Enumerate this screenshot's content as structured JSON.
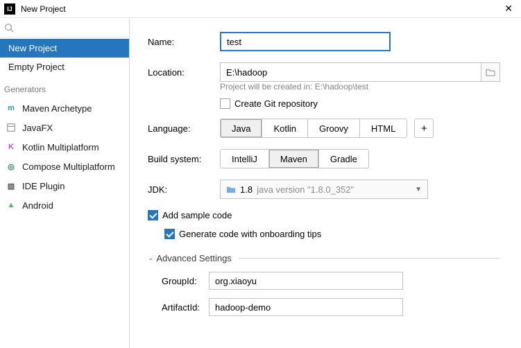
{
  "window": {
    "title": "New Project"
  },
  "sidebar": {
    "items": [
      {
        "label": "New Project"
      },
      {
        "label": "Empty Project"
      }
    ],
    "generators_header": "Generators",
    "generators": [
      {
        "label": "Maven Archetype",
        "icon_letter": "m",
        "icon_color": "#1f93d4"
      },
      {
        "label": "JavaFX",
        "icon_letter": "",
        "icon_color": "#7a7a7a"
      },
      {
        "label": "Kotlin Multiplatform",
        "icon_letter": "K",
        "icon_color": "#b84fe0"
      },
      {
        "label": "Compose Multiplatform",
        "icon_letter": "◎",
        "icon_color": "#2c7f6f"
      },
      {
        "label": "IDE Plugin",
        "icon_letter": "▧",
        "icon_color": "#5a5a5a"
      },
      {
        "label": "Android",
        "icon_letter": "▲",
        "icon_color": "#3bbd64"
      }
    ]
  },
  "form": {
    "name_label": "Name:",
    "name_value": "test",
    "location_label": "Location:",
    "location_value": "E:\\hadoop",
    "location_hint": "Project will be created in: E:\\hadoop\\test",
    "create_git_label": "Create Git repository",
    "language_label": "Language:",
    "languages": [
      {
        "label": "Java"
      },
      {
        "label": "Kotlin"
      },
      {
        "label": "Groovy"
      },
      {
        "label": "HTML"
      }
    ],
    "buildsystem_label": "Build system:",
    "buildsystems": [
      {
        "label": "IntelliJ"
      },
      {
        "label": "Maven"
      },
      {
        "label": "Gradle"
      }
    ],
    "jdk_label": "JDK:",
    "jdk_version": "1.8",
    "jdk_desc": "java version \"1.8.0_352\"",
    "add_sample_label": "Add sample code",
    "onboarding_label": "Generate code with onboarding tips",
    "advanced_header": "Advanced Settings",
    "groupid_label": "GroupId:",
    "groupid_value": "org.xiaoyu",
    "artifactid_label": "ArtifactId:",
    "artifactid_value": "hadoop-demo"
  }
}
